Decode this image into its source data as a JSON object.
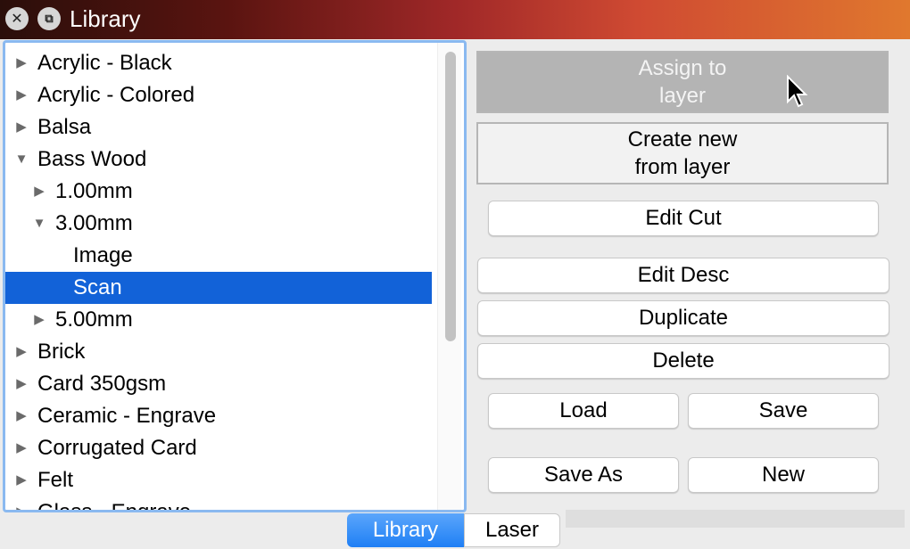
{
  "window": {
    "title": "Library"
  },
  "tree": [
    {
      "label": "Acrylic - Black",
      "depth": 0,
      "expander": "collapsed"
    },
    {
      "label": "Acrylic - Colored",
      "depth": 0,
      "expander": "collapsed"
    },
    {
      "label": "Balsa",
      "depth": 0,
      "expander": "collapsed"
    },
    {
      "label": "Bass Wood",
      "depth": 0,
      "expander": "expanded"
    },
    {
      "label": "1.00mm",
      "depth": 1,
      "expander": "collapsed"
    },
    {
      "label": "3.00mm",
      "depth": 1,
      "expander": "expanded"
    },
    {
      "label": "Image",
      "depth": 2,
      "expander": "none"
    },
    {
      "label": "Scan",
      "depth": 2,
      "expander": "none",
      "selected": true
    },
    {
      "label": "5.00mm",
      "depth": 1,
      "expander": "collapsed"
    },
    {
      "label": "Brick",
      "depth": 0,
      "expander": "collapsed"
    },
    {
      "label": "Card 350gsm",
      "depth": 0,
      "expander": "collapsed"
    },
    {
      "label": "Ceramic - Engrave",
      "depth": 0,
      "expander": "collapsed"
    },
    {
      "label": "Corrugated Card",
      "depth": 0,
      "expander": "collapsed"
    },
    {
      "label": "Felt",
      "depth": 0,
      "expander": "collapsed"
    },
    {
      "label": "Glass - Engrave",
      "depth": 0,
      "expander": "collapsed"
    }
  ],
  "buttons": {
    "assign_line1": "Assign to",
    "assign_line2": "layer",
    "create_line1": "Create new",
    "create_line2": "from layer",
    "edit_cut": "Edit Cut",
    "edit_desc": "Edit Desc",
    "duplicate": "Duplicate",
    "delete": "Delete",
    "load": "Load",
    "save": "Save",
    "save_as": "Save As",
    "new": "New"
  },
  "tabs": [
    {
      "label": "Library",
      "active": true
    },
    {
      "label": "Laser",
      "active": false
    }
  ],
  "colors": {
    "selection": "#1262d8",
    "focus_ring": "#8ab9f0",
    "active_tab": "#1f7ff5"
  }
}
